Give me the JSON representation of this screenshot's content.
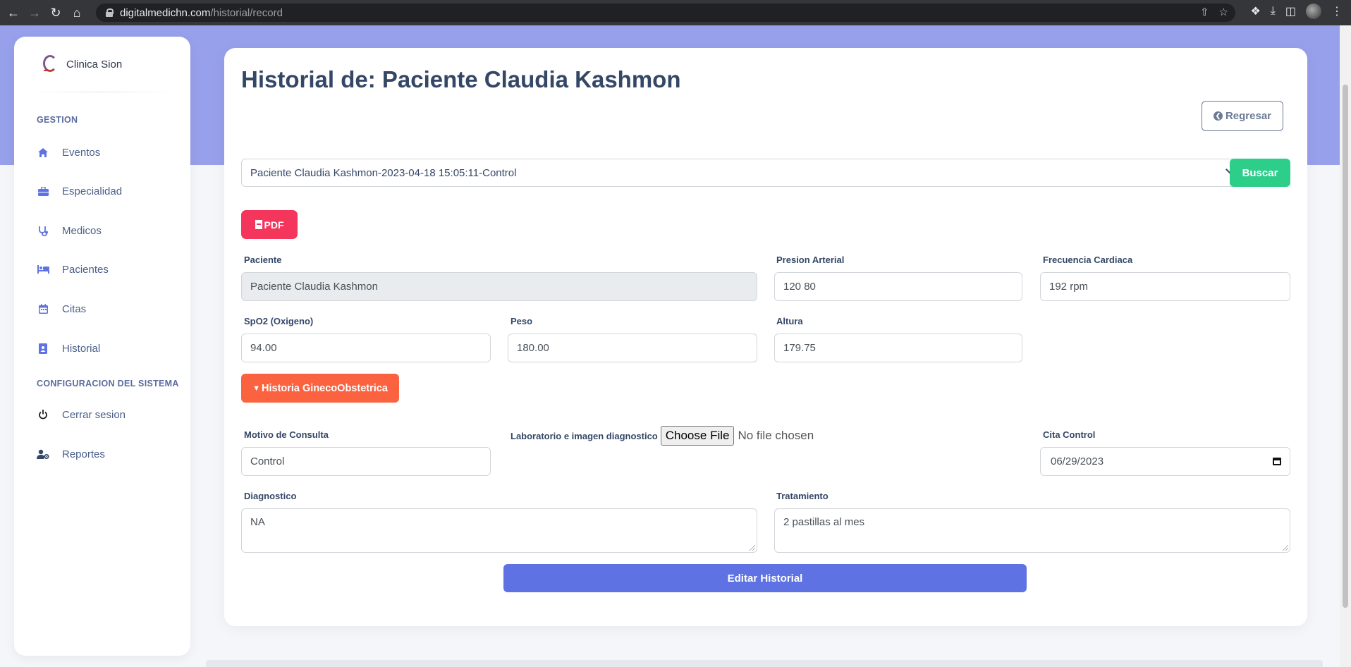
{
  "browser": {
    "url_domain": "digitalmedichn.com",
    "url_path": "/historial/record"
  },
  "sidebar": {
    "brand": "Clinica Sion",
    "section_gestion": "GESTION",
    "items": [
      {
        "label": "Eventos",
        "icon": "home-icon"
      },
      {
        "label": "Especialidad",
        "icon": "briefcase-icon"
      },
      {
        "label": "Medicos",
        "icon": "stethoscope-icon"
      },
      {
        "label": "Pacientes",
        "icon": "bed-icon"
      },
      {
        "label": "Citas",
        "icon": "calendar-icon"
      },
      {
        "label": "Historial",
        "icon": "id-badge-icon"
      }
    ],
    "section_config": "CONFIGURACION DEL SISTEMA",
    "config_items": [
      {
        "label": "Cerrar sesion",
        "icon": "power-icon"
      },
      {
        "label": "Reportes",
        "icon": "user-gear-icon"
      }
    ]
  },
  "main": {
    "title": "Historial de: Paciente Claudia Kashmon",
    "back_label": "Regresar",
    "record_select": "Paciente Claudia Kashmon-2023-04-18 15:05:11-Control",
    "search_label": "Buscar",
    "pdf_label": "PDF",
    "fields": {
      "paciente": {
        "label": "Paciente",
        "value": "Paciente Claudia Kashmon"
      },
      "presion": {
        "label": "Presion Arterial",
        "value": "120 80"
      },
      "frecuencia": {
        "label": "Frecuencia Cardiaca",
        "value": "192 rpm"
      },
      "spo2": {
        "label": "SpO2 (Oxigeno)",
        "value": "94.00"
      },
      "peso": {
        "label": "Peso",
        "value": "180.00"
      },
      "altura": {
        "label": "Altura",
        "value": "179.75"
      },
      "motivo": {
        "label": "Motivo de Consulta",
        "value": "Control"
      },
      "laboratorio": {
        "label": "Laboratorio e imagen diagnostico",
        "button": "Choose File",
        "status": "No file chosen"
      },
      "cita": {
        "label": "Cita Control",
        "value": "06/29/2023"
      },
      "diagnostico": {
        "label": "Diagnostico",
        "value": "NA"
      },
      "tratamiento": {
        "label": "Tratamiento",
        "value": "2 pastillas al mes"
      }
    },
    "gineco_label": "Historia GinecoObstetrica",
    "edit_label": "Editar Historial"
  },
  "colors": {
    "primary": "#5e72e4",
    "success": "#2dce89",
    "danger": "#f5365c",
    "warning": "#fb6340",
    "hero": "#97a0ea"
  }
}
